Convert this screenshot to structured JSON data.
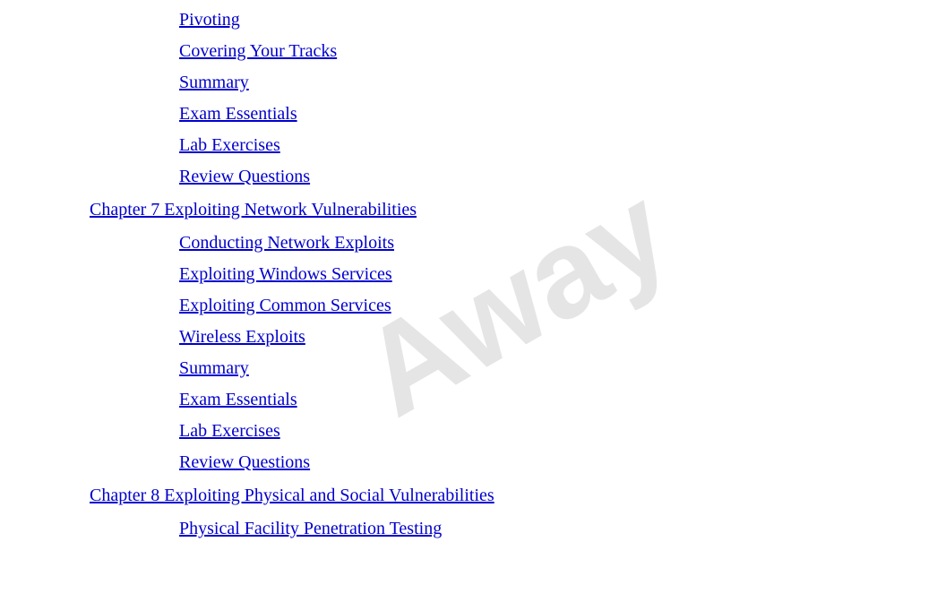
{
  "watermark": {
    "text": "Away"
  },
  "toc": {
    "items": [
      {
        "id": "pivoting",
        "label": "Pivoting",
        "type": "section",
        "indent": true
      },
      {
        "id": "covering-your-tracks",
        "label": "Covering Your Tracks",
        "type": "section",
        "indent": true
      },
      {
        "id": "summary-1",
        "label": "Summary",
        "type": "section",
        "indent": true
      },
      {
        "id": "exam-essentials-1",
        "label": "Exam Essentials",
        "type": "section",
        "indent": true
      },
      {
        "id": "lab-exercises-1",
        "label": "Lab Exercises",
        "type": "section",
        "indent": true
      },
      {
        "id": "review-questions-1",
        "label": "Review Questions",
        "type": "section",
        "indent": true
      },
      {
        "id": "chapter-7",
        "label": "Chapter 7 Exploiting Network Vulnerabilities",
        "type": "chapter",
        "indent": false
      },
      {
        "id": "conducting-network-exploits",
        "label": "Conducting Network Exploits",
        "type": "section",
        "indent": true
      },
      {
        "id": "exploiting-windows-services",
        "label": "Exploiting Windows Services",
        "type": "section",
        "indent": true
      },
      {
        "id": "exploiting-common-services",
        "label": "Exploiting Common Services",
        "type": "section",
        "indent": true
      },
      {
        "id": "wireless-exploits",
        "label": "Wireless Exploits",
        "type": "section",
        "indent": true
      },
      {
        "id": "summary-2",
        "label": "Summary",
        "type": "section",
        "indent": true
      },
      {
        "id": "exam-essentials-2",
        "label": "Exam Essentials",
        "type": "section",
        "indent": true
      },
      {
        "id": "lab-exercises-2",
        "label": "Lab Exercises",
        "type": "section",
        "indent": true
      },
      {
        "id": "review-questions-2",
        "label": "Review Questions",
        "type": "section",
        "indent": true
      },
      {
        "id": "chapter-8",
        "label": "Chapter 8 Exploiting Physical and Social Vulnerabilities",
        "type": "chapter",
        "indent": false
      },
      {
        "id": "physical-facility-penetration-testing",
        "label": "Physical Facility Penetration Testing",
        "type": "section",
        "indent": true
      }
    ]
  }
}
